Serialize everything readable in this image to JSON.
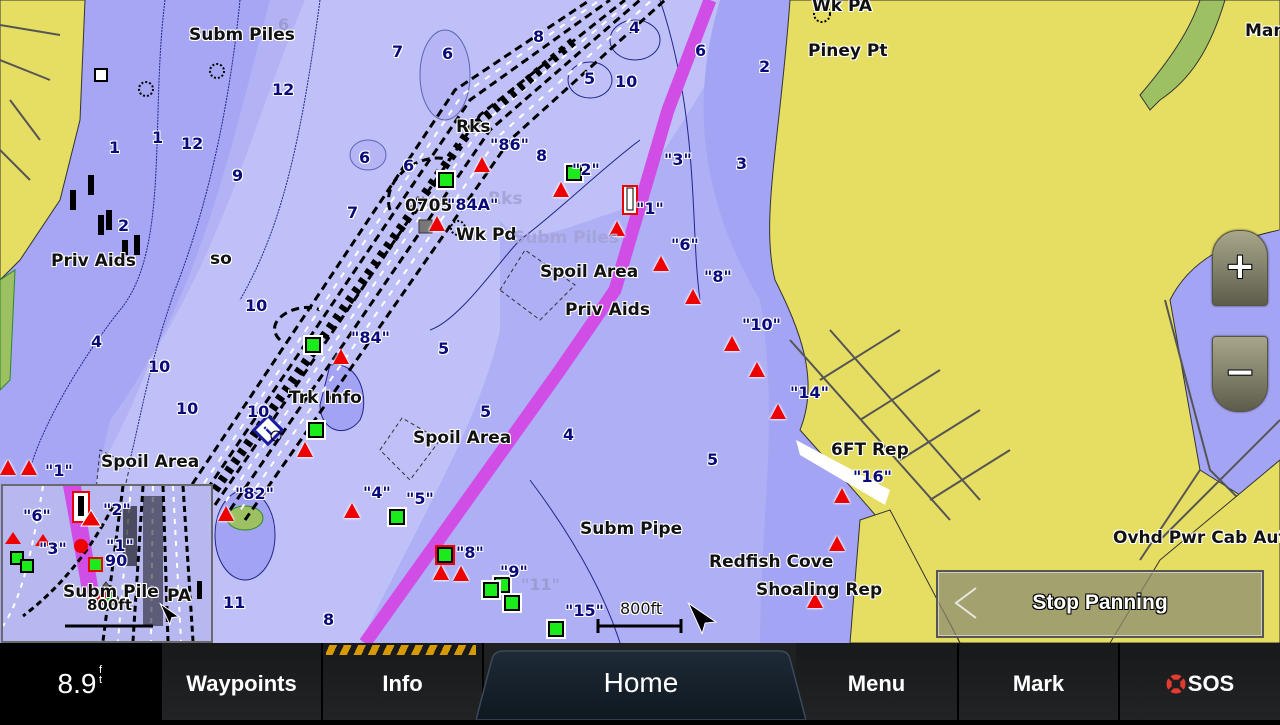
{
  "map": {
    "place_labels": [
      {
        "id": "subm-piles-top",
        "text": "Subm Piles"
      },
      {
        "id": "wk-pa",
        "text": "Wk PA"
      },
      {
        "id": "piney-pt",
        "text": "Piney Pt"
      },
      {
        "id": "man",
        "text": "Man"
      },
      {
        "id": "rks",
        "text": "Rks"
      },
      {
        "id": "wk-pd",
        "text": "Wk Pd"
      },
      {
        "id": "spoil-area-1",
        "text": "Spoil Area"
      },
      {
        "id": "priv-aids-1",
        "text": "Priv Aids"
      },
      {
        "id": "priv-aids-2",
        "text": "Priv Aids"
      },
      {
        "id": "so",
        "text": "so"
      },
      {
        "id": "trk-info",
        "text": "Trk Info"
      },
      {
        "id": "spoil-area-2",
        "text": "Spoil Area"
      },
      {
        "id": "spoil-area-3",
        "text": "Spoil Area"
      },
      {
        "id": "subm-pipe",
        "text": "Subm Pipe"
      },
      {
        "id": "redfish-cove",
        "text": "Redfish Cove"
      },
      {
        "id": "shoaling-rep",
        "text": "Shoaling Rep"
      },
      {
        "id": "sixft-rep",
        "text": "6FT Rep"
      },
      {
        "id": "ovhd-pwr",
        "text": "Ovhd Pwr Cab Aut"
      },
      {
        "id": "code-0705",
        "text": "0705"
      },
      {
        "id": "subm-piles-faint",
        "text": "Subm Piles"
      },
      {
        "id": "rks-faint",
        "text": "Rks"
      }
    ],
    "marker_labels": [
      "\"86\"",
      "\"2\"",
      "\"3\"",
      "\"1\"",
      "\"84A\"",
      "\"6\"",
      "\"8\"",
      "\"10\"",
      "\"14\"",
      "\"16\"",
      "\"84\"",
      "\"82\"",
      "\"4\"",
      "\"5\"",
      "\"8\"",
      "\"9\"",
      "\"11\"",
      "\"15\"",
      "\"1\""
    ],
    "soundings": [
      "6",
      "7",
      "6",
      "12",
      "1",
      "12",
      "1",
      "9",
      "2",
      "7",
      "6",
      "6",
      "8",
      "8",
      "5",
      "10",
      "4",
      "6",
      "2",
      "3",
      "10",
      "4",
      "10",
      "10",
      "5",
      "5",
      "4",
      "5",
      "11",
      "8",
      "10"
    ],
    "scale": {
      "label": "800ft"
    },
    "compass": {
      "label": "N"
    }
  },
  "inset": {
    "labels": [
      "\"6\"",
      "\"2\"",
      "\"3\"",
      "\"1\"",
      "90",
      "Subm Pile",
      "PA"
    ],
    "scale": {
      "label": "800ft"
    }
  },
  "controls": {
    "zoom_in": "+",
    "zoom_out": "−",
    "stop_panning": "Stop Panning"
  },
  "bottombar": {
    "depth": {
      "value": "8.9",
      "unit_top": "f",
      "unit_bottom": "t"
    },
    "items": [
      {
        "id": "waypoints",
        "label": "Waypoints"
      },
      {
        "id": "info",
        "label": "Info"
      },
      {
        "id": "home",
        "label": "Home"
      },
      {
        "id": "menu",
        "label": "Menu"
      },
      {
        "id": "mark",
        "label": "Mark"
      },
      {
        "id": "sos",
        "label": "SOS"
      }
    ]
  },
  "colors": {
    "land": "#e6de62",
    "shallow": "#a0a0f4",
    "mid": "#b0b0f6",
    "deep": "#c2c2fa",
    "route": "#d04ee6",
    "red_buoy": "#ee0000",
    "green_marker": "#1bea1b",
    "hazard_stripe": "#d69a00"
  }
}
